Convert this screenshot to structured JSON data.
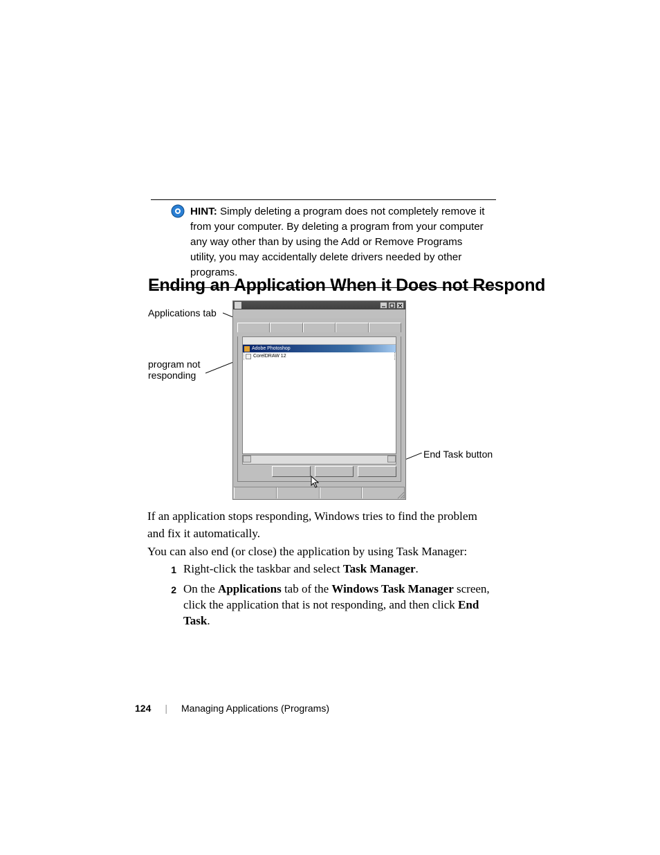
{
  "hint": {
    "label": "HINT:",
    "text": " Simply deleting a program does not completely remove it from your computer. By deleting a program from your computer any way other than by using the Add or Remove Programs utility, you may accidentally delete drivers needed by other programs."
  },
  "heading": "Ending an Application When it Does not Respond",
  "callouts": {
    "apps_tab": "Applications tab",
    "not_responding": "program not responding",
    "end_task": "End Task button"
  },
  "taskmgr": {
    "rows": [
      "Adobe Photoshop",
      "CorelDRAW 12"
    ]
  },
  "para1": "If an application stops responding, Windows tries to find the problem and fix it automatically.",
  "para2": "You can also end (or close) the application by using Task Manager:",
  "steps": {
    "s1": {
      "n": "1",
      "pre": "Right-click the taskbar and select ",
      "b1": "Task Manager",
      "post": "."
    },
    "s2": {
      "n": "2",
      "t1": "On the ",
      "b1": "Applications",
      "t2": " tab of the ",
      "b2": "Windows Task Manager",
      "t3": " screen, click the application that is not responding, and then click ",
      "b3": "End Task",
      "t4": "."
    }
  },
  "footer": {
    "page": "124",
    "sep": "|",
    "section": "Managing Applications (Programs)"
  }
}
